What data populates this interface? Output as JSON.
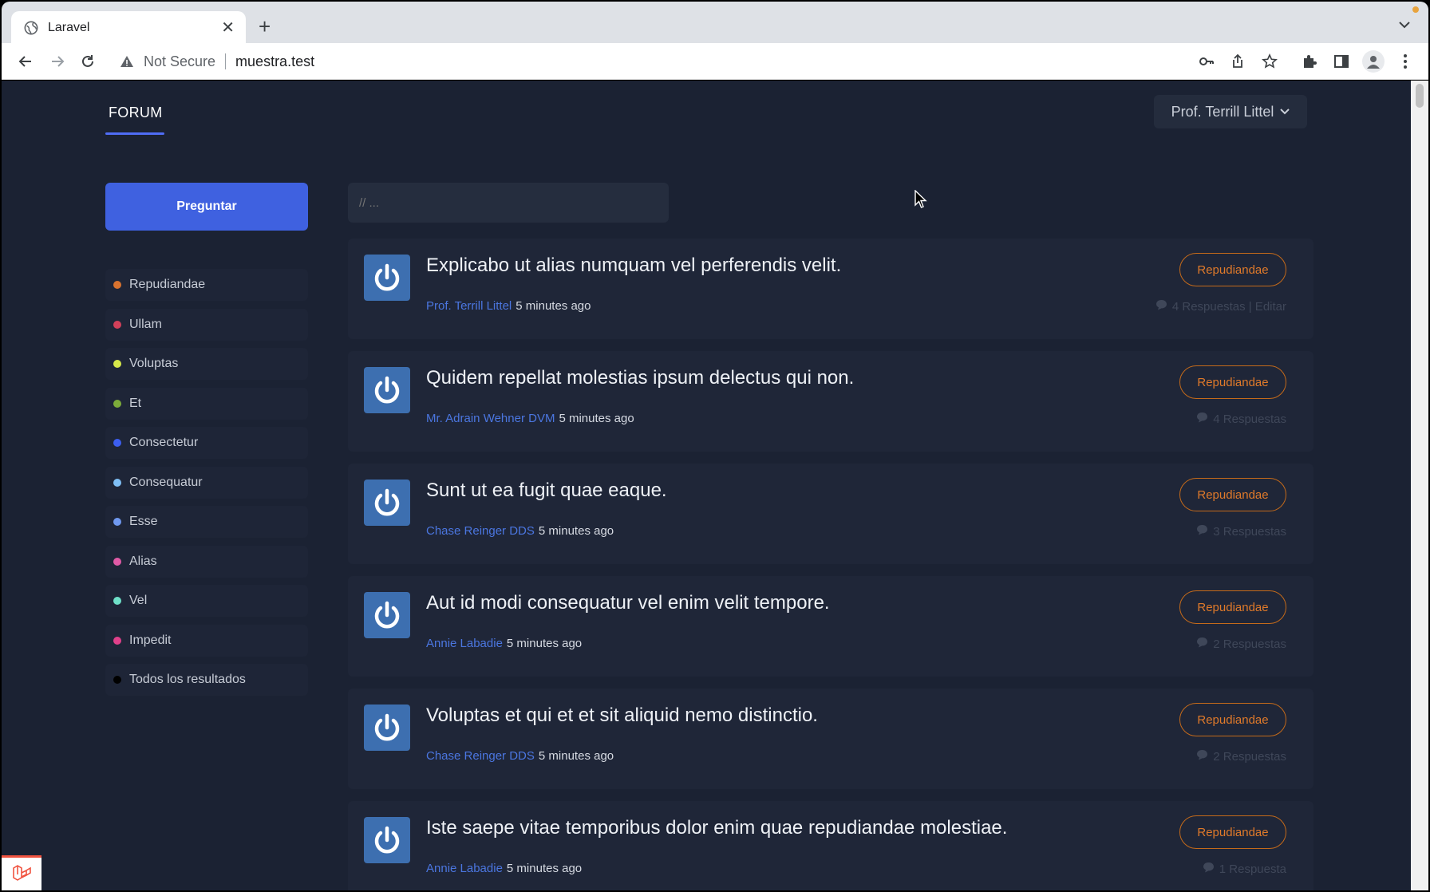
{
  "browser": {
    "tab_title": "Laravel",
    "security_label": "Not Secure",
    "url": "muestra.test"
  },
  "nav": {
    "forum_label": "FORUM",
    "user_name": "Prof. Terrill Littel"
  },
  "sidebar": {
    "ask_button": "Preguntar",
    "categories": [
      {
        "label": "Repudiandae",
        "color": "#d9732f"
      },
      {
        "label": "Ullam",
        "color": "#d2405a"
      },
      {
        "label": "Voluptas",
        "color": "#d6e84a"
      },
      {
        "label": "Et",
        "color": "#7cab3a"
      },
      {
        "label": "Consectetur",
        "color": "#3c5ef0"
      },
      {
        "label": "Consequatur",
        "color": "#7fbff5"
      },
      {
        "label": "Esse",
        "color": "#6f98ef"
      },
      {
        "label": "Alias",
        "color": "#e05aa6"
      },
      {
        "label": "Vel",
        "color": "#6fe0c8"
      },
      {
        "label": "Impedit",
        "color": "#e0408a"
      },
      {
        "label": "Todos los resultados",
        "color": "#000000"
      }
    ]
  },
  "search": {
    "placeholder": "// ..."
  },
  "threads": [
    {
      "title": "Explicabo ut alias numquam vel perferendis velit.",
      "author": "Prof. Terrill Littel",
      "time": "5 minutes ago",
      "category": "Repudiandae",
      "replies": "4 Respuestas | Editar"
    },
    {
      "title": "Quidem repellat molestias ipsum delectus qui non.",
      "author": "Mr. Adrain Wehner DVM",
      "time": "5 minutes ago",
      "category": "Repudiandae",
      "replies": "4 Respuestas"
    },
    {
      "title": "Sunt ut ea fugit quae eaque.",
      "author": "Chase Reinger DDS",
      "time": "5 minutes ago",
      "category": "Repudiandae",
      "replies": "3 Respuestas"
    },
    {
      "title": "Aut id modi consequatur vel enim velit tempore.",
      "author": "Annie Labadie",
      "time": "5 minutes ago",
      "category": "Repudiandae",
      "replies": "2 Respuestas"
    },
    {
      "title": "Voluptas et qui et et sit aliquid nemo distinctio.",
      "author": "Chase Reinger DDS",
      "time": "5 minutes ago",
      "category": "Repudiandae",
      "replies": "2 Respuestas"
    },
    {
      "title": "Iste saepe vitae temporibus dolor enim quae repudiandae molestiae.",
      "author": "Annie Labadie",
      "time": "5 minutes ago",
      "category": "Repudiandae",
      "replies": "1 Respuesta"
    }
  ]
}
